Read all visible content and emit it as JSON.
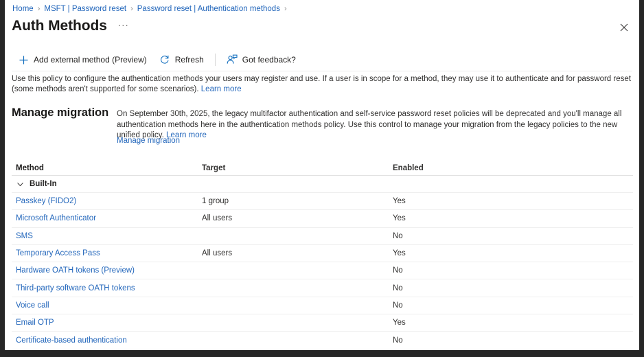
{
  "breadcrumb": {
    "items": [
      {
        "label": "Home"
      },
      {
        "label": "MSFT | Password reset"
      },
      {
        "label": "Password reset | Authentication methods"
      }
    ],
    "separator": "›"
  },
  "header": {
    "title": "Auth Methods",
    "more_label": "···",
    "close_label": "✕"
  },
  "toolbar": {
    "add_label": "Add external method (Preview)",
    "refresh_label": "Refresh",
    "feedback_label": "Got feedback?"
  },
  "description": {
    "text": "Use this policy to configure the authentication methods your users may register and use. If a user is in scope for a method, they may use it to authenticate and for password reset (some methods aren't supported for some scenarios).",
    "link": "Learn more"
  },
  "manage_migration": {
    "heading": "Manage migration",
    "body": "On September 30th, 2025, the legacy multifactor authentication and self-service password reset policies will be deprecated and you'll manage all authentication methods here in the authentication methods policy. Use this control to manage your migration from the legacy policies to the new unified policy.",
    "body_link": "Learn more",
    "action_link": "Manage migration"
  },
  "table": {
    "columns": {
      "method": "Method",
      "target": "Target",
      "enabled": "Enabled"
    },
    "group_label": "Built-In",
    "rows": [
      {
        "method": "Passkey (FIDO2)",
        "target": "1 group",
        "enabled": "Yes"
      },
      {
        "method": "Microsoft Authenticator",
        "target": "All users",
        "enabled": "Yes"
      },
      {
        "method": "SMS",
        "target": "",
        "enabled": "No"
      },
      {
        "method": "Temporary Access Pass",
        "target": "All users",
        "enabled": "Yes"
      },
      {
        "method": "Hardware OATH tokens (Preview)",
        "target": "",
        "enabled": "No"
      },
      {
        "method": "Third-party software OATH tokens",
        "target": "",
        "enabled": "No"
      },
      {
        "method": "Voice call",
        "target": "",
        "enabled": "No"
      },
      {
        "method": "Email OTP",
        "target": "",
        "enabled": "Yes"
      },
      {
        "method": "Certificate-based authentication",
        "target": "",
        "enabled": "No"
      }
    ]
  },
  "colors": {
    "link": "#2266bb",
    "accent": "#0f6cbd",
    "text": "#323130",
    "frame_border": "#262626"
  }
}
